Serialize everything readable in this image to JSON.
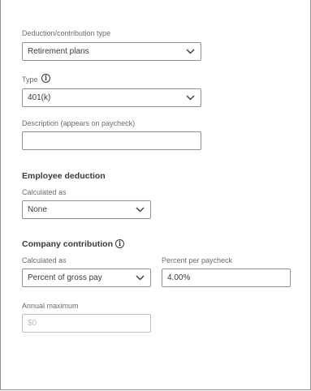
{
  "deduction_type": {
    "label": "Deduction/contribution type",
    "value": "Retirement plans"
  },
  "type": {
    "label": "Type",
    "value": "401(k)"
  },
  "description": {
    "label": "Description (appears on paycheck)",
    "value": ""
  },
  "employee_deduction": {
    "heading": "Employee deduction",
    "calculated_label": "Calculated as",
    "calculated_value": "None"
  },
  "company_contribution": {
    "heading": "Company contribution",
    "calculated_label": "Calculated as",
    "calculated_value": "Percent of gross pay",
    "percent_label": "Percent per paycheck",
    "percent_value": "4.00%",
    "annual_max_label": "Annual maximum",
    "annual_max_placeholder": "$0"
  },
  "icons": {
    "chevron": "chevron-down-icon",
    "info": "info-icon"
  }
}
